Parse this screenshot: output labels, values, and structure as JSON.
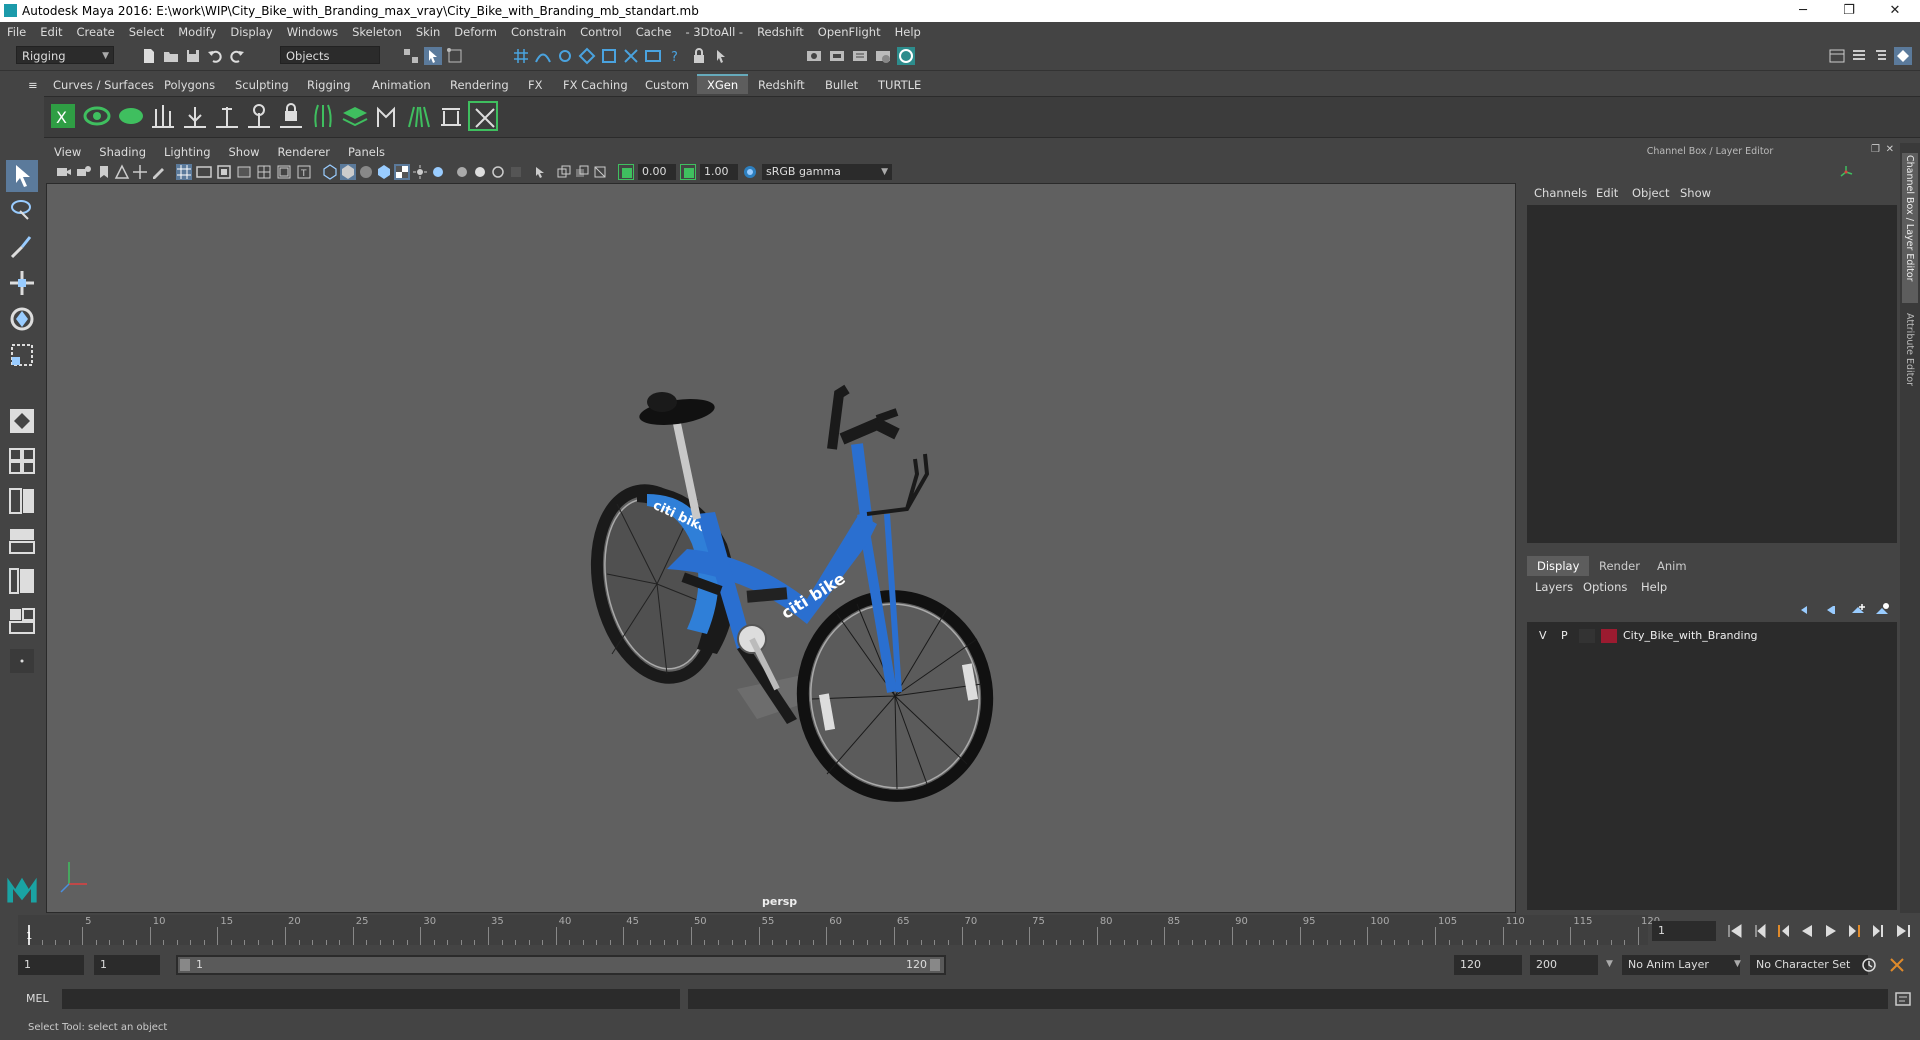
{
  "app": {
    "title": "Autodesk Maya 2016: E:\\work\\WIP\\City_Bike_with_Branding_max_vray\\City_Bike_with_Branding_mb_standart.mb",
    "window_controls": [
      "─",
      "❐",
      "✕"
    ]
  },
  "menubar": [
    "File",
    "Edit",
    "Create",
    "Select",
    "Modify",
    "Display",
    "Windows",
    "Skeleton",
    "Skin",
    "Deform",
    "Constrain",
    "Control",
    "Cache",
    "- 3DtoAll -",
    "Redshift",
    "OpenFlight",
    "Help"
  ],
  "status_line": {
    "menu_set": "Rigging",
    "selection_mode": "Objects"
  },
  "shelf": {
    "tabs": [
      "Curves / Surfaces",
      "Polygons",
      "Sculpting",
      "Rigging",
      "Animation",
      "Rendering",
      "FX",
      "FX Caching",
      "Custom",
      "XGen",
      "Redshift",
      "Bullet",
      "TURTLE"
    ],
    "active_tab": "XGen"
  },
  "viewport": {
    "menu": [
      "View",
      "Shading",
      "Lighting",
      "Show",
      "Renderer",
      "Panels"
    ],
    "exposure": "0.00",
    "gamma": "1.00",
    "color_space": "sRGB gamma",
    "camera": "persp",
    "branding_text": "citi bike"
  },
  "channel_box": {
    "title": "Channel Box / Layer Editor",
    "menu": [
      "Channels",
      "Edit",
      "Object",
      "Show"
    ]
  },
  "layer_editor": {
    "tabs": [
      "Display",
      "Render",
      "Anim"
    ],
    "active_tab": "Display",
    "menu": [
      "Layers",
      "Options",
      "Help"
    ],
    "layers": [
      {
        "visible": "V",
        "playback": "P",
        "name": "City_Bike_with_Branding",
        "color": "#9b1b30"
      }
    ]
  },
  "side_tabs": [
    "Channel Box / Layer Editor",
    "Attribute Editor"
  ],
  "time_slider": {
    "ticks": [
      5,
      10,
      15,
      20,
      25,
      30,
      35,
      40,
      45,
      50,
      55,
      60,
      65,
      70,
      75,
      80,
      85,
      90,
      95,
      100,
      105,
      110,
      115,
      120
    ],
    "current_frame_label": "1",
    "current_frame_field": "1"
  },
  "range_slider": {
    "start_time": "1",
    "playback_start": "1",
    "range_start_label": "1",
    "range_end_label": "120",
    "playback_end": "120",
    "end_time": "200",
    "anim_layer": "No Anim Layer",
    "character_set": "No Character Set"
  },
  "command_line": {
    "label": "MEL"
  },
  "help_line": {
    "text": "Select Tool: select an object"
  }
}
